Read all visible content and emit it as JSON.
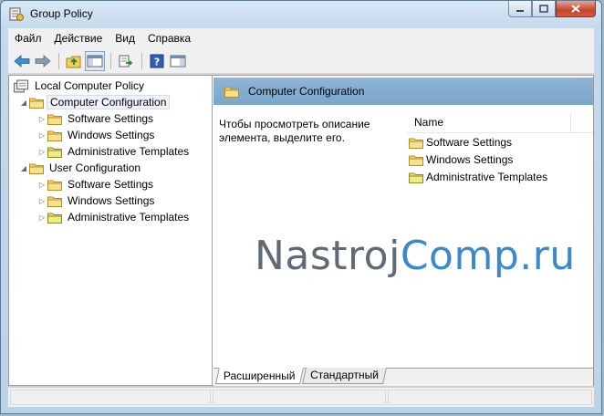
{
  "window": {
    "title": "Group Policy"
  },
  "menu": {
    "items": [
      "Файл",
      "Действие",
      "Вид",
      "Справка"
    ]
  },
  "tree": {
    "root": "Local Computer Policy",
    "computer": {
      "label": "Computer Configuration",
      "children": [
        "Software Settings",
        "Windows Settings",
        "Administrative Templates"
      ]
    },
    "user": {
      "label": "User Configuration",
      "children": [
        "Software Settings",
        "Windows Settings",
        "Administrative Templates"
      ]
    }
  },
  "details": {
    "header": "Computer Configuration",
    "description": "Чтобы просмотреть описание элемента, выделите его.",
    "column_name": "Name",
    "items": [
      "Software Settings",
      "Windows Settings",
      "Administrative Templates"
    ]
  },
  "tabs": [
    "Расширенный",
    "Стандартный"
  ],
  "watermark": {
    "part1": "Nastroj",
    "part2": "Comp.ru"
  }
}
